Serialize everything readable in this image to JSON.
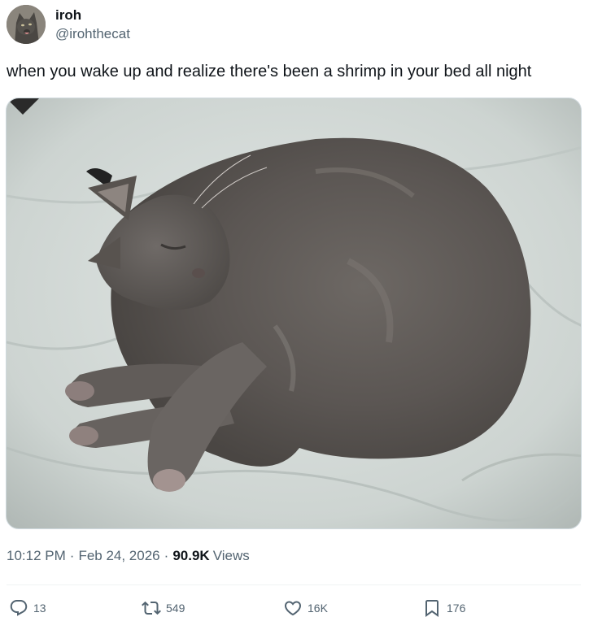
{
  "author": {
    "display_name": "iroh",
    "handle": "@irohthecat",
    "avatar_icon": "cat-avatar"
  },
  "tweet": {
    "text": "when you wake up and realize there's been a shrimp in your bed all night",
    "media_description_icon": "cat-photo"
  },
  "meta": {
    "time": "10:12 PM",
    "separator": "·",
    "date": "Feb 24, 2026",
    "views_count": "90.9K",
    "views_label": "Views"
  },
  "actions": {
    "replies": "13",
    "reposts": "549",
    "likes": "16K",
    "bookmarks": "176"
  },
  "colors": {
    "text_primary": "#0f1419",
    "text_secondary": "#536471",
    "divider": "#eff3f4",
    "media_border": "#cfd9de"
  }
}
